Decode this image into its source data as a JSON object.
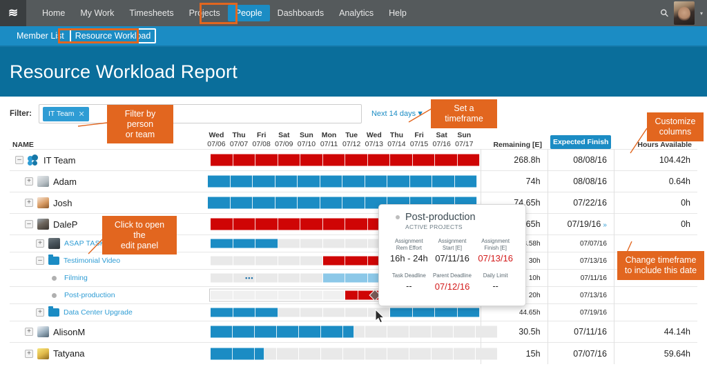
{
  "topnav": {
    "logo_glyph": "≋",
    "items": [
      {
        "label": "Home",
        "active": false
      },
      {
        "label": "My Work",
        "active": false
      },
      {
        "label": "Timesheets",
        "active": false
      },
      {
        "label": "Projects",
        "active": false
      },
      {
        "label": "People",
        "active": true
      },
      {
        "label": "Dashboards",
        "active": false
      },
      {
        "label": "Analytics",
        "active": false
      },
      {
        "label": "Help",
        "active": false
      }
    ],
    "search_icon": "search-icon",
    "avatar_caret": "▾"
  },
  "subnav": {
    "items": [
      {
        "label": "Member List",
        "boxed": false
      },
      {
        "label": "Resource Workload",
        "boxed": true
      }
    ]
  },
  "page": {
    "title": "Resource Workload Report"
  },
  "filter": {
    "label": "Filter:",
    "chip": "IT Team",
    "chip_remove": "✕",
    "timeframe": "Next 14 days",
    "timeframe_caret": "▼"
  },
  "columns": {
    "name": "NAME",
    "remaining": "Remaining [E]",
    "expected_finish": "Expected Finish",
    "hours_available": "Hours Available"
  },
  "days": [
    {
      "dow": "Wed",
      "date": "07/06"
    },
    {
      "dow": "Thu",
      "date": "07/07"
    },
    {
      "dow": "Fri",
      "date": "07/08"
    },
    {
      "dow": "Sat",
      "date": "07/09"
    },
    {
      "dow": "Sun",
      "date": "07/10"
    },
    {
      "dow": "Mon",
      "date": "07/11"
    },
    {
      "dow": "Tue",
      "date": "07/12"
    },
    {
      "dow": "Wed",
      "date": "07/13"
    },
    {
      "dow": "Thu",
      "date": "07/14"
    },
    {
      "dow": "Fri",
      "date": "07/15"
    },
    {
      "dow": "Sat",
      "date": "07/16"
    },
    {
      "dow": "Sun",
      "date": "07/17"
    }
  ],
  "rows": [
    {
      "name": "IT Team",
      "remaining": "268.8h",
      "finish": "08/08/16",
      "available": "104.42h",
      "toggle": "–"
    },
    {
      "name": "Adam",
      "remaining": "74h",
      "finish": "08/08/16",
      "available": "0.64h",
      "toggle": "+"
    },
    {
      "name": "Josh",
      "remaining": "74.65h",
      "finish": "07/22/16",
      "available": "0h",
      "toggle": "+"
    },
    {
      "name": "DaleP",
      "remaining": "74.65h",
      "finish": "07/19/16",
      "available": "0h",
      "toggle": "–",
      "finish_chev": "»"
    },
    {
      "name": "ASAP TASKS",
      "remaining": "18.58h",
      "finish": "07/07/16",
      "available": "",
      "toggle": "+"
    },
    {
      "name": "Testimonial Video",
      "remaining": "30h",
      "finish": "07/13/16",
      "available": "",
      "toggle": "–"
    },
    {
      "name": "Filming",
      "remaining": "10h",
      "finish": "07/11/16",
      "available": "",
      "toggle": ""
    },
    {
      "name": "Post-production",
      "remaining": "20h",
      "finish": "07/13/16",
      "available": "",
      "toggle": ""
    },
    {
      "name": "Data Center Upgrade",
      "remaining": "44.65h",
      "finish": "07/19/16",
      "available": "",
      "toggle": "+"
    },
    {
      "name": "AlisonM",
      "remaining": "30.5h",
      "finish": "07/11/16",
      "available": "44.14h",
      "toggle": "+"
    },
    {
      "name": "Tatyana",
      "remaining": "15h",
      "finish": "07/07/16",
      "available": "59.64h",
      "toggle": "+"
    }
  ],
  "popup": {
    "title": "Post-production",
    "subtitle": "ACTIVE PROJECTS",
    "fields": [
      {
        "key": "Assignment\nRem Effort",
        "key1": "Assignment",
        "key2": "Rem Effort",
        "value": "16h - 24h",
        "red": false
      },
      {
        "key1": "Assignment",
        "key2": "Start [E]",
        "value": "07/11/16",
        "red": false
      },
      {
        "key1": "Assignment",
        "key2": "Finish [E]",
        "value": "07/13/16",
        "red": true
      }
    ],
    "fields2": [
      {
        "key1": "Task Deadline",
        "key2": "",
        "value": "--",
        "red": false
      },
      {
        "key1": "Parent Deadline",
        "key2": "",
        "value": "07/12/16",
        "red": true
      },
      {
        "key1": "Daily Limit",
        "key2": "",
        "value": "--",
        "red": false
      }
    ]
  },
  "annotations": [
    {
      "id": "filter-by",
      "line1": "Filter by person",
      "line2": "or team"
    },
    {
      "id": "set-timeframe",
      "line1": "Set a timeframe",
      "line2": ""
    },
    {
      "id": "customize-columns",
      "line1": "Customize",
      "line2": "columns"
    },
    {
      "id": "click-edit-panel",
      "line1": "Click to open the",
      "line2": "edit panel"
    },
    {
      "id": "change-timeframe",
      "line1": "Change timeframe",
      "line2": "to include this date"
    }
  ],
  "colors": {
    "accent_blue": "#1b8cc4",
    "header_blue": "#0a6e9b",
    "nav_gray": "#555a5c",
    "overload_red": "#cf0505",
    "annotation_orange": "#e2661f",
    "light_blue": "#8cc8e8",
    "empty_gray": "#e9e9e9"
  }
}
